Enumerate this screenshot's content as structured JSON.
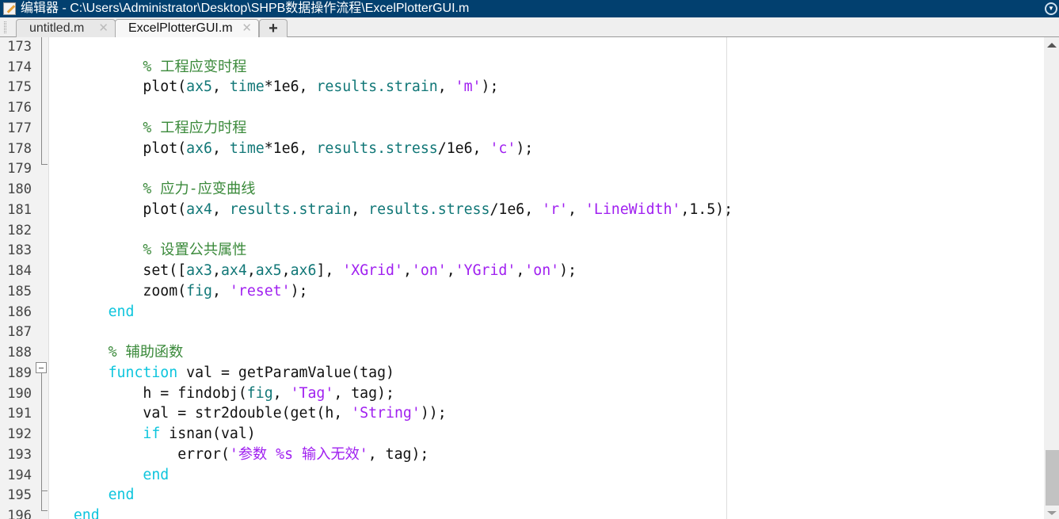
{
  "window": {
    "title": "编辑器 - C:\\Users\\Administrator\\Desktop\\SHPB数据操作流程\\ExcelPlotterGUI.m"
  },
  "tabs": [
    {
      "label": "untitled.m",
      "active": false
    },
    {
      "label": "ExcelPlotterGUI.m",
      "active": true
    }
  ],
  "add_tab_label": "+",
  "tab_close_glyph": "✕",
  "colors": {
    "titlebar": "#02406f",
    "keyword": "#0ec5dd",
    "variable": "#117777",
    "string": "#a020f0",
    "comment": "#3b8a3b"
  },
  "lines": [
    {
      "n": "173",
      "tokens": []
    },
    {
      "n": "174",
      "tokens": [
        [
          "pl",
          "            "
        ],
        [
          "com",
          "% 工程应变时程"
        ]
      ]
    },
    {
      "n": "175",
      "tokens": [
        [
          "pl",
          "            plot("
        ],
        [
          "var",
          "ax5"
        ],
        [
          "pl",
          ", "
        ],
        [
          "var",
          "time"
        ],
        [
          "pl",
          "*1e6, "
        ],
        [
          "var",
          "results.strain"
        ],
        [
          "pl",
          ", "
        ],
        [
          "str",
          "'m'"
        ],
        [
          "pl",
          ");"
        ]
      ]
    },
    {
      "n": "176",
      "tokens": []
    },
    {
      "n": "177",
      "tokens": [
        [
          "pl",
          "            "
        ],
        [
          "com",
          "% 工程应力时程"
        ]
      ]
    },
    {
      "n": "178",
      "tokens": [
        [
          "pl",
          "            plot("
        ],
        [
          "var",
          "ax6"
        ],
        [
          "pl",
          ", "
        ],
        [
          "var",
          "time"
        ],
        [
          "pl",
          "*1e6, "
        ],
        [
          "var",
          "results.stress"
        ],
        [
          "pl",
          "/1e6, "
        ],
        [
          "str",
          "'c'"
        ],
        [
          "pl",
          ");"
        ]
      ]
    },
    {
      "n": "179",
      "tokens": []
    },
    {
      "n": "180",
      "tokens": [
        [
          "pl",
          "            "
        ],
        [
          "com",
          "% 应力-应变曲线"
        ]
      ]
    },
    {
      "n": "181",
      "tokens": [
        [
          "pl",
          "            plot("
        ],
        [
          "var",
          "ax4"
        ],
        [
          "pl",
          ", "
        ],
        [
          "var",
          "results.strain"
        ],
        [
          "pl",
          ", "
        ],
        [
          "var",
          "results.stress"
        ],
        [
          "pl",
          "/1e6, "
        ],
        [
          "str",
          "'r'"
        ],
        [
          "pl",
          ", "
        ],
        [
          "str",
          "'LineWidth'"
        ],
        [
          "pl",
          ",1.5);"
        ]
      ]
    },
    {
      "n": "182",
      "tokens": []
    },
    {
      "n": "183",
      "tokens": [
        [
          "pl",
          "            "
        ],
        [
          "com",
          "% 设置公共属性"
        ]
      ]
    },
    {
      "n": "184",
      "tokens": [
        [
          "pl",
          "            set(["
        ],
        [
          "var",
          "ax3"
        ],
        [
          "pl",
          ","
        ],
        [
          "var",
          "ax4"
        ],
        [
          "pl",
          ","
        ],
        [
          "var",
          "ax5"
        ],
        [
          "pl",
          ","
        ],
        [
          "var",
          "ax6"
        ],
        [
          "pl",
          "], "
        ],
        [
          "str",
          "'XGrid'"
        ],
        [
          "pl",
          ","
        ],
        [
          "str",
          "'on'"
        ],
        [
          "pl",
          ","
        ],
        [
          "str",
          "'YGrid'"
        ],
        [
          "pl",
          ","
        ],
        [
          "str",
          "'on'"
        ],
        [
          "pl",
          ");"
        ]
      ]
    },
    {
      "n": "185",
      "tokens": [
        [
          "pl",
          "            zoom("
        ],
        [
          "var",
          "fig"
        ],
        [
          "pl",
          ", "
        ],
        [
          "str",
          "'reset'"
        ],
        [
          "pl",
          ");"
        ]
      ]
    },
    {
      "n": "186",
      "tokens": [
        [
          "pl",
          "        "
        ],
        [
          "kw",
          "end"
        ]
      ]
    },
    {
      "n": "187",
      "tokens": []
    },
    {
      "n": "188",
      "tokens": [
        [
          "pl",
          "        "
        ],
        [
          "com",
          "% 辅助函数"
        ]
      ]
    },
    {
      "n": "189",
      "tokens": [
        [
          "pl",
          "        "
        ],
        [
          "kw",
          "function"
        ],
        [
          "pl",
          " val = getParamValue(tag)"
        ]
      ]
    },
    {
      "n": "190",
      "tokens": [
        [
          "pl",
          "            h = findobj("
        ],
        [
          "var",
          "fig"
        ],
        [
          "pl",
          ", "
        ],
        [
          "str",
          "'Tag'"
        ],
        [
          "pl",
          ", tag);"
        ]
      ]
    },
    {
      "n": "191",
      "tokens": [
        [
          "pl",
          "            val = str2double(get(h, "
        ],
        [
          "str",
          "'String'"
        ],
        [
          "pl",
          "));"
        ]
      ]
    },
    {
      "n": "192",
      "tokens": [
        [
          "pl",
          "            "
        ],
        [
          "kw",
          "if"
        ],
        [
          "pl",
          " isnan(val)"
        ]
      ]
    },
    {
      "n": "193",
      "tokens": [
        [
          "pl",
          "                error("
        ],
        [
          "str",
          "'参数 %s 输入无效'"
        ],
        [
          "pl",
          ", tag);"
        ]
      ]
    },
    {
      "n": "194",
      "tokens": [
        [
          "pl",
          "            "
        ],
        [
          "kw",
          "end"
        ]
      ]
    },
    {
      "n": "195",
      "tokens": [
        [
          "pl",
          "        "
        ],
        [
          "kw",
          "end"
        ]
      ]
    },
    {
      "n": "196",
      "tokens": [
        [
          "pl",
          "    "
        ],
        [
          "kw",
          "end"
        ]
      ]
    }
  ]
}
